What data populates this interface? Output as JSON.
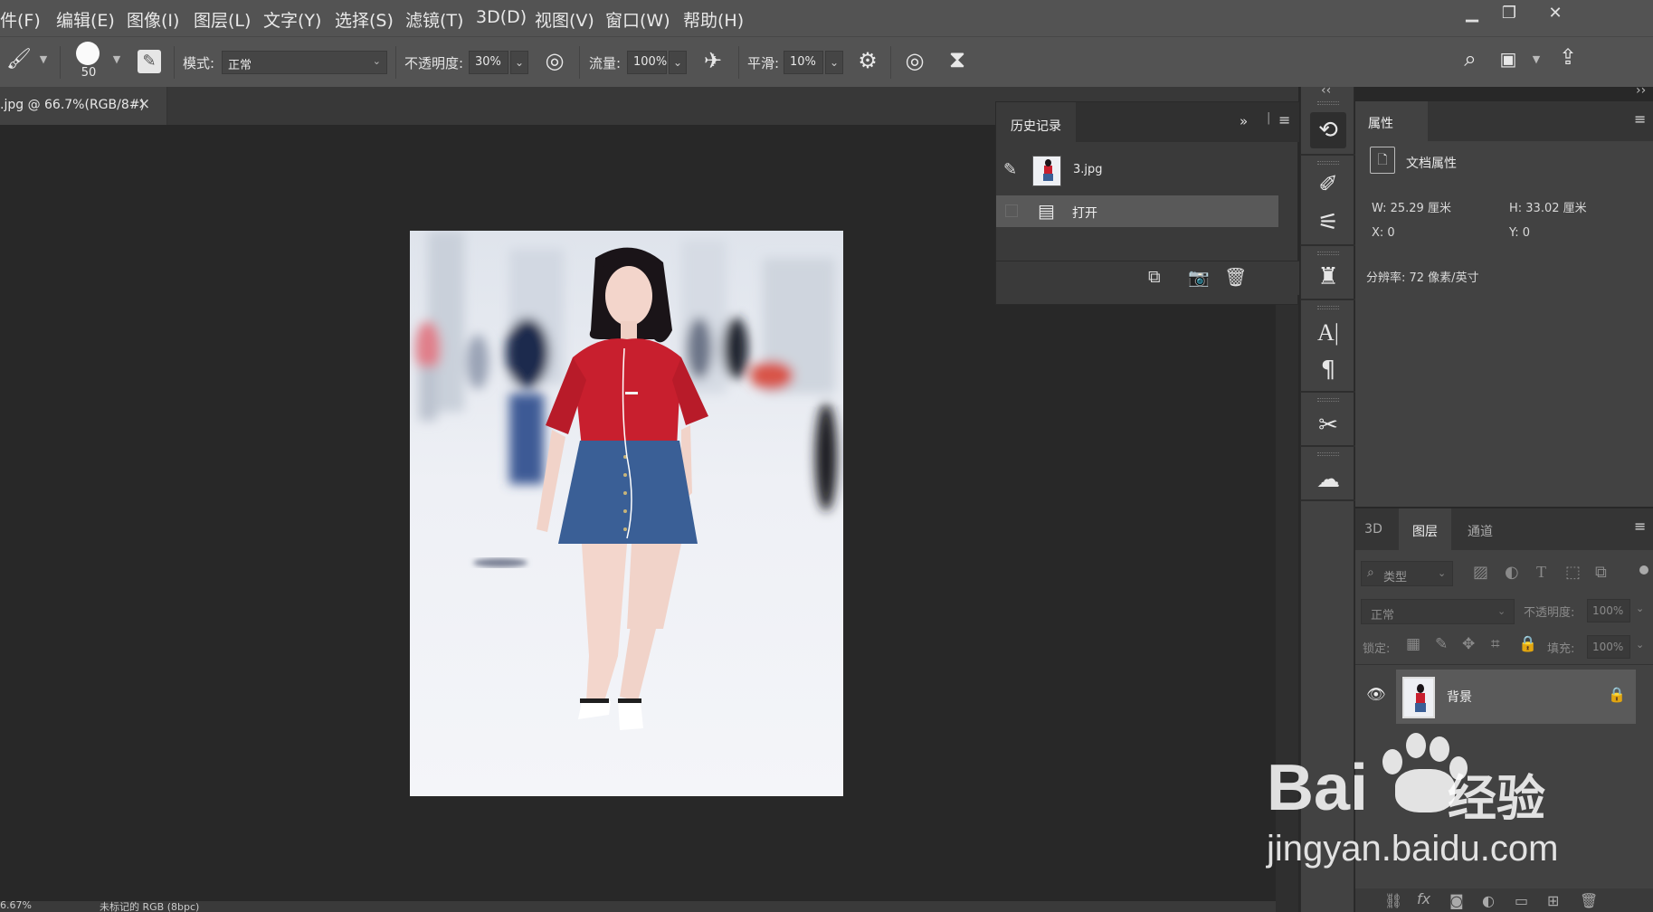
{
  "menubar": {
    "items": [
      "件(F)",
      "编辑(E)",
      "图像(I)",
      "图层(L)",
      "文字(Y)",
      "选择(S)",
      "滤镜(T)",
      "3D(D)",
      "视图(V)",
      "窗口(W)",
      "帮助(H)"
    ]
  },
  "options": {
    "brush_size": "50",
    "mode_label": "模式:",
    "mode_value": "正常",
    "opacity_label": "不透明度:",
    "opacity_value": "30%",
    "flow_label": "流量:",
    "flow_value": "100%",
    "smooth_label": "平滑:",
    "smooth_value": "10%"
  },
  "document": {
    "tab_title": ".jpg @ 66.7%(RGB/8#)",
    "close_glyph": "×"
  },
  "history": {
    "tab_label": "历史记录",
    "snapshot_name": "3.jpg",
    "steps": [
      "打开"
    ]
  },
  "properties": {
    "tab_label": "属性",
    "section_label": "文档属性",
    "width": "W:  25.29 厘米",
    "height": "H:  33.02 厘米",
    "x": "X:  0",
    "y": "Y:  0",
    "resolution": "分辨率: 72 像素/英寸"
  },
  "layers": {
    "tabs": [
      "3D",
      "图层",
      "通道"
    ],
    "active_tab": 1,
    "filter_placeholder": "类型",
    "blend_mode": "正常",
    "opacity_label": "不透明度:",
    "opacity_value": "100%",
    "lock_label": "锁定:",
    "fill_label": "填充:",
    "fill_value": "100%",
    "layer_name": "背景"
  },
  "status": {
    "zoom": "6.67%",
    "info": "未标记的 RGB (8bpc)"
  },
  "watermark": {
    "brand": "Bai",
    "brand_cn": "经验",
    "url": "jingyan.baidu.com"
  },
  "colors": {
    "shirt": "#c81f2e",
    "skirt": "#3a5f96",
    "panel": "#424242"
  }
}
